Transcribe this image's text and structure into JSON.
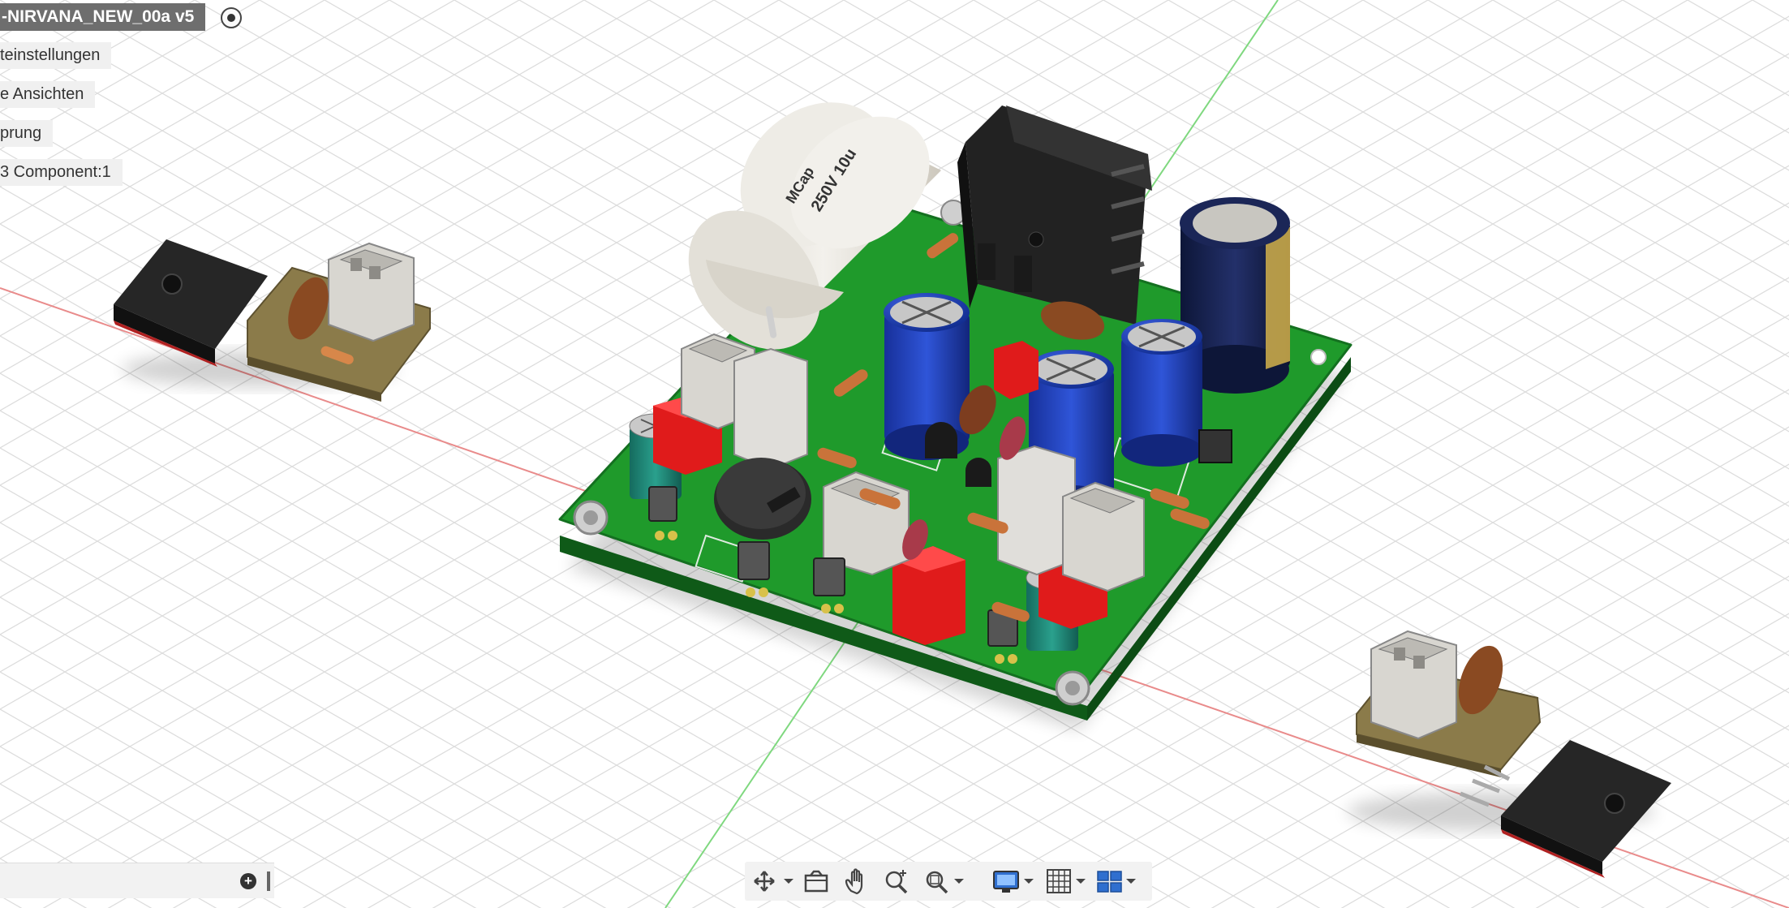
{
  "browser": {
    "title": "-NIRVANA_NEW_00a v5",
    "items": [
      {
        "label": "teinstellungen"
      },
      {
        "label": "e Ansichten"
      },
      {
        "label": "prung"
      },
      {
        "label": "3 Component:1"
      }
    ]
  },
  "canvas": {
    "capacitor_brand": "MCap",
    "capacitor_rating": "250V 10u"
  },
  "navbar": {
    "tools": [
      {
        "icon": "orbit-icon"
      },
      {
        "icon": "look-at-icon"
      },
      {
        "icon": "pan-hand-icon"
      },
      {
        "icon": "zoom-icon"
      },
      {
        "icon": "zoom-window-icon"
      },
      {
        "icon": "display-settings-icon"
      },
      {
        "icon": "grid-settings-icon"
      },
      {
        "icon": "viewports-icon"
      }
    ]
  },
  "colors": {
    "pcb": "#1f9a2b",
    "axis_x": "#e98b8b",
    "axis_y": "#7fd87f",
    "grid": "#d9d9d9",
    "capacitor_blue": "#1e3fb8",
    "capacitor_green": "#1f8a7a",
    "film_red": "#e01b1b"
  }
}
